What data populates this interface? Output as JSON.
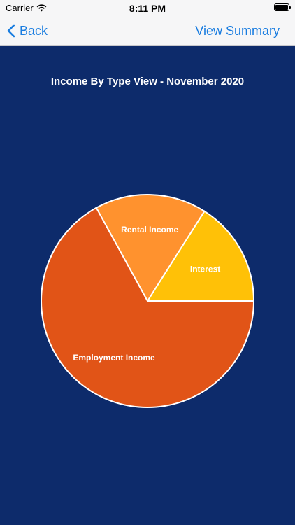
{
  "status_bar": {
    "carrier": "Carrier",
    "time": "8:11 PM"
  },
  "nav": {
    "back_label": "Back",
    "right_label": "View Summary"
  },
  "chart_data": {
    "type": "pie",
    "title": "Income By Type View - November 2020",
    "slices": [
      {
        "label": "Interest",
        "value": 16,
        "color": "#ffc107"
      },
      {
        "label": "Rental Income",
        "value": 17,
        "color": "#ff922e"
      },
      {
        "label": "Employment Income",
        "value": 67,
        "color": "#e15417"
      }
    ]
  }
}
